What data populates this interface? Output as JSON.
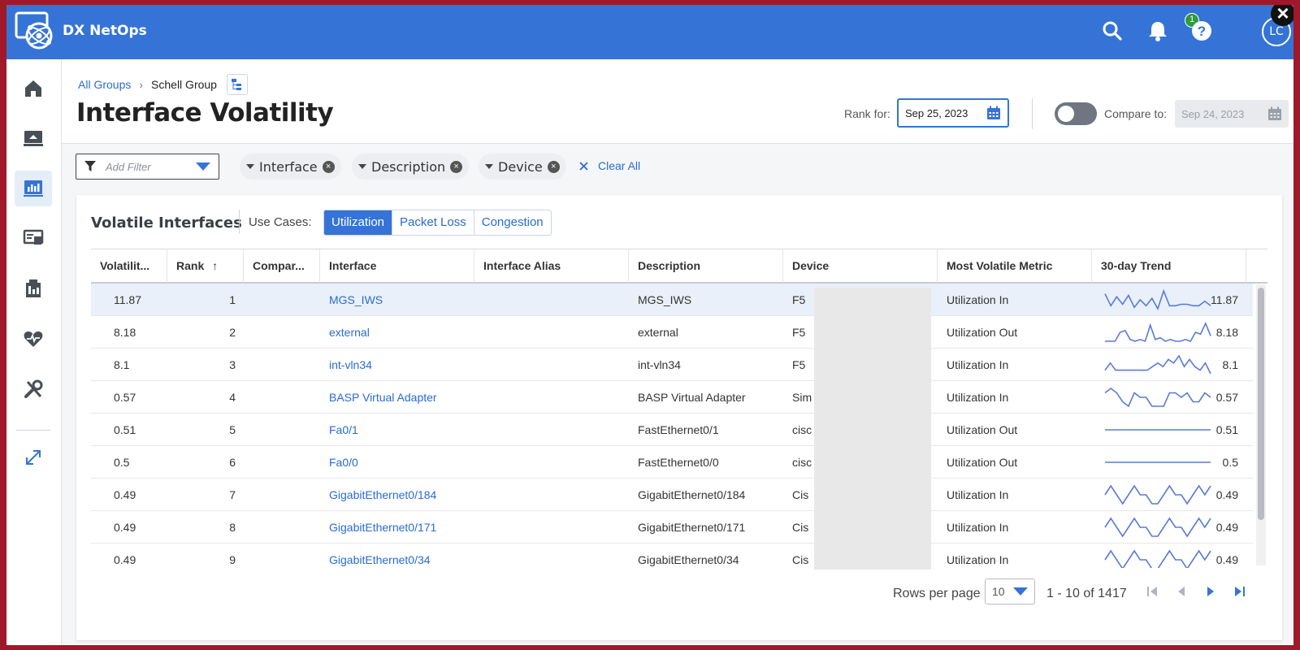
{
  "app": {
    "name": "DX NetOps",
    "notifications": "1",
    "avatar": "LC"
  },
  "breadcrumb": {
    "root": "All Groups",
    "current": "Schell Group"
  },
  "page": {
    "title": "Interface Volatility",
    "rank_label": "Rank for:",
    "rank_date": "Sep 25, 2023",
    "compare_label": "Compare to:",
    "compare_date": "Sep 24, 2023"
  },
  "filters": {
    "placeholder": "Add Filter",
    "chips": [
      "Interface",
      "Description",
      "Device"
    ],
    "clear_all": "Clear All"
  },
  "card": {
    "title": "Volatile Interfaces",
    "use_cases_label": "Use Cases:",
    "use_cases": [
      "Utilization",
      "Packet Loss",
      "Congestion"
    ],
    "selected_use_case": "Utilization"
  },
  "table": {
    "columns": [
      "Volatilit...",
      "Rank",
      "Compar...",
      "Interface",
      "Interface Alias",
      "Description",
      "Device",
      "Most Volatile Metric",
      "30-day Trend"
    ],
    "sort_column": "Rank",
    "rows": [
      {
        "volatility": "11.87",
        "rank": "1",
        "compare": "",
        "interface": "MGS_IWS",
        "alias": "",
        "description": "MGS_IWS",
        "device": "F5",
        "metric": "Utilization In",
        "trend_value": "11.87",
        "trend": [
          10,
          2,
          8,
          3,
          9,
          1,
          6,
          2,
          7,
          0,
          12,
          2,
          2,
          3,
          3,
          2,
          2,
          5,
          2
        ]
      },
      {
        "volatility": "8.18",
        "rank": "2",
        "compare": "",
        "interface": "external",
        "alias": "",
        "description": "external",
        "device": "F5",
        "metric": "Utilization Out",
        "trend_value": "8.18",
        "trend": [
          1,
          1,
          1,
          6,
          7,
          2,
          1,
          2,
          1,
          10,
          2,
          3,
          1,
          2,
          1,
          1,
          2,
          1,
          6,
          5,
          11,
          4
        ]
      },
      {
        "volatility": "8.1",
        "rank": "3",
        "compare": "",
        "interface": "int-vln34",
        "alias": "",
        "description": "int-vln34",
        "device": "F5",
        "metric": "Utilization In",
        "trend_value": "8.1",
        "trend": [
          2,
          4,
          2,
          2,
          2,
          2,
          2,
          2,
          2,
          3,
          4,
          3,
          5,
          4,
          6,
          3,
          5,
          3,
          2,
          4,
          1
        ]
      },
      {
        "volatility": "0.57",
        "rank": "4",
        "compare": "",
        "interface": "BASP Virtual Adapter",
        "alias": "",
        "description": "BASP Virtual Adapter",
        "device": "Sim",
        "metric": "Utilization In",
        "trend_value": "0.57",
        "trend": [
          5,
          6,
          5,
          3,
          2,
          5,
          4,
          4,
          2,
          2,
          2,
          5,
          5,
          4,
          5,
          3,
          3,
          5,
          4
        ]
      },
      {
        "volatility": "0.51",
        "rank": "5",
        "compare": "",
        "interface": "Fa0/1",
        "alias": "",
        "description": "FastEthernet0/1",
        "device": "cisc",
        "metric": "Utilization Out",
        "trend_value": "0.51",
        "trend": [
          5,
          5,
          5,
          5,
          5,
          5,
          5,
          5,
          5,
          5,
          5,
          5,
          5,
          5,
          5,
          5,
          5,
          5,
          5
        ]
      },
      {
        "volatility": "0.5",
        "rank": "6",
        "compare": "",
        "interface": "Fa0/0",
        "alias": "",
        "description": "FastEthernet0/0",
        "device": "cisc",
        "metric": "Utilization Out",
        "trend_value": "0.5",
        "trend": [
          5,
          5,
          5,
          5,
          5,
          5,
          5,
          5,
          5,
          5,
          5,
          5,
          5,
          5,
          5,
          5,
          5,
          5,
          5
        ]
      },
      {
        "volatility": "0.49",
        "rank": "7",
        "compare": "",
        "interface": "GigabitEthernet0/184",
        "alias": "",
        "description": "GigabitEthernet0/184",
        "device": "Cis",
        "metric": "Utilization In",
        "trend_value": "0.49",
        "trend": [
          4,
          5,
          4,
          3,
          4,
          5,
          4,
          4,
          3,
          3,
          4,
          5,
          4,
          4,
          3,
          4,
          5,
          4,
          5
        ]
      },
      {
        "volatility": "0.49",
        "rank": "8",
        "compare": "",
        "interface": "GigabitEthernet0/171",
        "alias": "",
        "description": "GigabitEthernet0/171",
        "device": "Cis",
        "metric": "Utilization In",
        "trend_value": "0.49",
        "trend": [
          4,
          5,
          4,
          3,
          4,
          5,
          4,
          4,
          3,
          3,
          4,
          5,
          4,
          4,
          3,
          4,
          5,
          4,
          5
        ]
      },
      {
        "volatility": "0.49",
        "rank": "9",
        "compare": "",
        "interface": "GigabitEthernet0/34",
        "alias": "",
        "description": "GigabitEthernet0/34",
        "device": "Cis",
        "metric": "Utilization In",
        "trend_value": "0.49",
        "trend": [
          4,
          5,
          4,
          3,
          4,
          5,
          4,
          4,
          3,
          3,
          4,
          5,
          4,
          4,
          3,
          4,
          5,
          4,
          5
        ]
      }
    ]
  },
  "pager": {
    "rows_per_page_label": "Rows per page",
    "rows_per_page": "10",
    "range": "1 - 10 of 1417"
  },
  "colors": {
    "accent": "#3574d6",
    "link": "#2a6bd1",
    "sparkline": "#5a7bd6",
    "badge": "#2e9a42"
  },
  "icons": [
    "logo-icon",
    "search-icon",
    "bell-icon",
    "help-icon",
    "close-icon",
    "home-icon",
    "monitor-icon",
    "dashboard-icon",
    "reports-icon",
    "inventory-icon",
    "health-icon",
    "tools-icon",
    "expand-icon",
    "hierarchy-icon",
    "calendar-icon",
    "filter-icon",
    "chevron-down-icon",
    "clear-icon",
    "sort-up-icon",
    "first-page-icon",
    "prev-page-icon",
    "next-page-icon",
    "last-page-icon"
  ]
}
